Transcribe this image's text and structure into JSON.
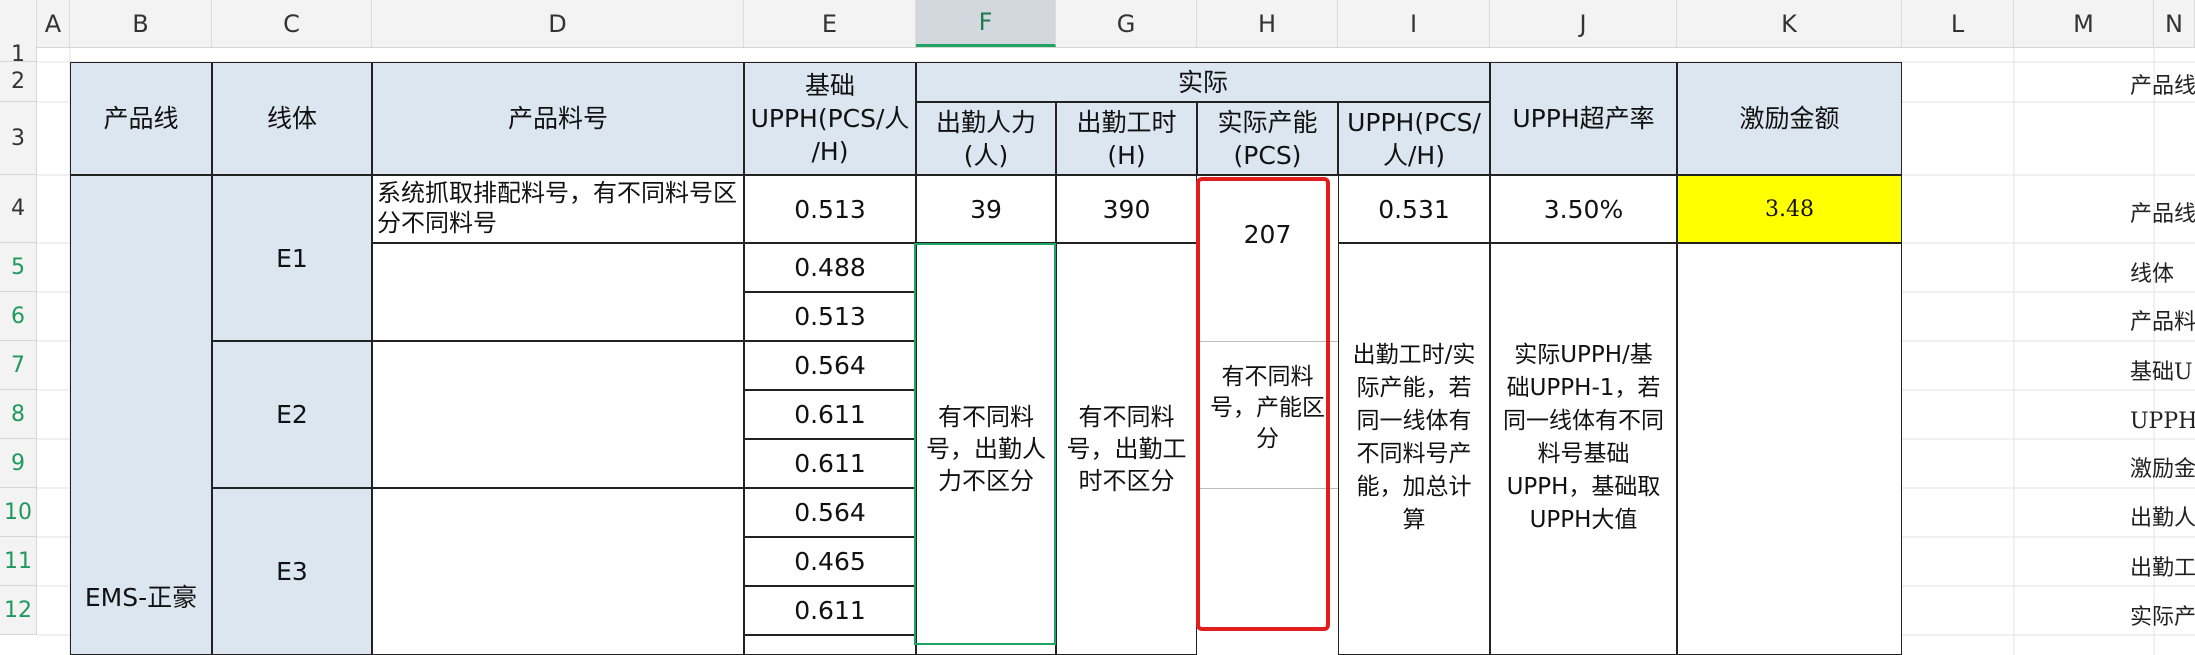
{
  "columns": [
    "A",
    "B",
    "C",
    "D",
    "E",
    "F",
    "G",
    "H",
    "I",
    "J",
    "K",
    "L",
    "M",
    "N"
  ],
  "rows": [
    "1",
    "2",
    "3",
    "4",
    "5",
    "6",
    "7",
    "8",
    "9",
    "10",
    "11",
    "12"
  ],
  "header": {
    "product_line": "产品线",
    "line_body": "线体",
    "part_no": "产品料号",
    "base_upph": "基础\nUPPH(PCS/人\n/H)",
    "actual_group": "实际",
    "attend_staff": "出勤人力\n(人)",
    "attend_hours": "出勤工时\n(H)",
    "actual_capacity": "实际产能\n(PCS)",
    "upph_actual": "UPPH(PCS/\n人/H)",
    "upph_over_rate": "UPPH超产率",
    "incentive": "激励金额"
  },
  "body": {
    "product_line_value": "EMS-正豪",
    "lines": [
      "E1",
      "E2",
      "E3"
    ],
    "part_note": "系统抓取排配料号，有不同料号区分不同料号",
    "base_upph_values": [
      "0.513",
      "0.488",
      "0.513",
      "0.564",
      "0.611",
      "0.611",
      "0.564",
      "0.465",
      "0.611"
    ],
    "row4": {
      "staff": "39",
      "hours": "390",
      "upph": "0.531",
      "over_rate": "3.50%",
      "incentive": "3.48"
    },
    "capacity_207": "207",
    "note_staff": "有不同料\n号，出勤人\n力不区分",
    "note_hours": "有不同料\n号，出勤工\n时不区分",
    "note_capacity": "有不同料\n号，产能区\n分",
    "note_upph": "出勤工时/实\n际产能，若\n同一线体有\n不同料号产\n能，加总计\n算",
    "note_over": "实际UPPH/基\n础UPPH-1，若\n同一线体有不同\n料号基础\nUPPH，基础取\nUPPH大值"
  },
  "right_labels": [
    "产品线",
    "产品线",
    "线体",
    "产品料",
    "基础U",
    "UPPH超",
    "激励金",
    "出勤人",
    "出勤工",
    "实际产"
  ],
  "colors": {
    "header_fill": "#dce6f1",
    "highlight_yellow": "#ffff00",
    "red_box": "#e11d1d",
    "green_box": "#21a366"
  }
}
